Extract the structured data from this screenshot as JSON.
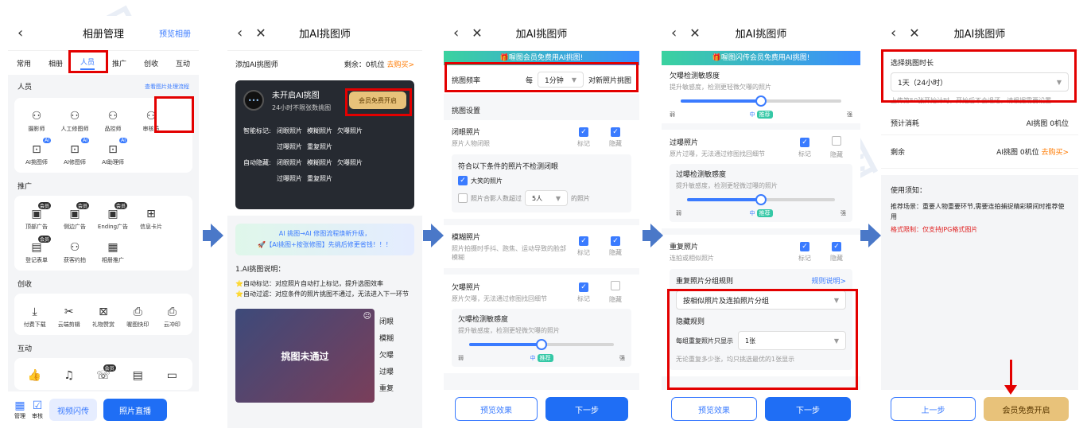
{
  "watermark": "喔图",
  "panel1": {
    "title": "相册管理",
    "right_link": "预览相册",
    "tabs": [
      "常用",
      "相册",
      "人员",
      "推广",
      "创收",
      "互动"
    ],
    "section_people": "人员",
    "people_link": "查看图片处理流程",
    "people_items": [
      "摄影师",
      "人工修图师",
      "品控师",
      "审核员",
      "AI挑图师",
      "AI修图师",
      "AI助理师"
    ],
    "section_promo": "推广",
    "promo_items": [
      "顶部广告",
      "侧边广告",
      "Ending广告",
      "信息卡片",
      "登记表单",
      "获客约拍",
      "相册推广"
    ],
    "section_revenue": "创收",
    "revenue_items": [
      "付费下载",
      "云端剪辑",
      "礼物赞赏",
      "喔图快印",
      "云冲印"
    ],
    "section_interact": "互动",
    "bottom": {
      "manage": "管理",
      "review": "审核",
      "video": "视频闪传",
      "live": "照片直播"
    },
    "vip": "会员",
    "ai": "AI"
  },
  "panel2": {
    "title": "加AI挑图师",
    "add_label": "添加AI挑图师",
    "remain": "剩余：0机位",
    "buy": "去购买>",
    "status": "未开启AI挑图",
    "desc": "24小时不限张数挑图",
    "cta": "会员免费开启",
    "smart_mark": "智能标记:",
    "auto_hide": "自动隐藏:",
    "tags": [
      "闭眼照片",
      "模糊照片",
      "欠曝照片",
      "过曝照片",
      "重复照片"
    ],
    "promo_line1": "AI 挑图→AI 修图流程焕新升级，",
    "promo_line2": "🚀【AI挑图+按张修图】先挑后修更省钱！！！",
    "explain_title": "1.AI挑图说明：",
    "explain1": "⭐自动标记：对应照片自动打上标记，提升选图效率",
    "explain2": "⭐自动过滤：对应条件的照片挑图不通过，无法进入下一环节",
    "image_caption": "挑图未通过",
    "side_labels": [
      "闭眼",
      "模糊",
      "欠曝",
      "过曝",
      "重复"
    ]
  },
  "panel3": {
    "title": "加AI挑图师",
    "banner": "🎁喔图会员免费用AI挑图!",
    "freq_label": "挑图频率",
    "freq_every": "每",
    "freq_value": "1分钟",
    "freq_suffix": "对新照片挑图",
    "settings": "挑图设置",
    "closed_eyes": "闭眼照片",
    "closed_eyes_sub": "原片人物闭眼",
    "mark": "标记",
    "hide": "隐藏",
    "exclude_title": "符合以下条件的照片不检测闭眼",
    "exclude_smile": "大笑的照片",
    "exclude_group_pre": "照片合影人数超过",
    "exclude_group_val": "5人",
    "exclude_group_post": "的照片",
    "blur": "模糊照片",
    "blur_sub": "照片拍摄时手抖、跑焦、运动导致的脸部模糊",
    "under": "欠曝照片",
    "under_sub": "原片欠曝，无法通过修图找回细节",
    "under_sens": "欠曝检测敏感度",
    "under_sens_sub": "提升敏感度，检测更轻微欠曝的照片",
    "weak": "弱",
    "mid": "中",
    "strong": "强",
    "recommend": "推荐",
    "preview": "预览效果",
    "next": "下一步",
    "under_sens_level": 0.5
  },
  "panel4": {
    "title": "加AI挑图师",
    "banner": "🎁喔图闪传会员免费用AI挑图!",
    "under_sens": "欠曝检测敏感度",
    "under_sens_sub": "提升敏感度，检测更轻微欠曝的照片",
    "over": "过曝照片",
    "over_sub": "原片过曝，无法通过修图找回细节",
    "over_sens": "过曝检测敏感度",
    "over_sens_sub": "提升敏感度，检测更轻微过曝的照片",
    "dup": "重复照片",
    "dup_sub": "连拍或相似照片",
    "group_rule": "重复照片分组规则",
    "rule_link": "规则说明>",
    "group_value": "按相似照片及连拍照片分组",
    "hide_rule": "隐藏规则",
    "hide_pre": "每组重复照片只显示",
    "hide_val": "1张",
    "hide_note": "无论重复多少张，均只挑选最优的1张显示",
    "mark": "标记",
    "hide": "隐藏",
    "weak": "弱",
    "mid": "中",
    "strong": "强",
    "recommend": "推荐",
    "preview": "预览效果",
    "next": "下一步",
    "sens_level": 0.5
  },
  "panel5": {
    "title": "加AI挑图师",
    "duration_label": "选择挑图时长",
    "duration_value": "1天（24小时）",
    "duration_note": "上传第50张开始计时，开始后不会退还，请根据需要设置",
    "cost_label": "预计消耗",
    "cost_value": "AI挑图 0机位",
    "remain_label": "剩余",
    "remain_value": "AI挑图 0机位",
    "buy": "去购买>",
    "notice_title": "使用须知：",
    "notice_scene": "推荐场景：重要人物重要环节,需要连拍捕捉精彩瞬间时推荐使用",
    "notice_format": "格式限制：仅支持JPG格式图片",
    "prev": "上一步",
    "open": "会员免费开启"
  }
}
